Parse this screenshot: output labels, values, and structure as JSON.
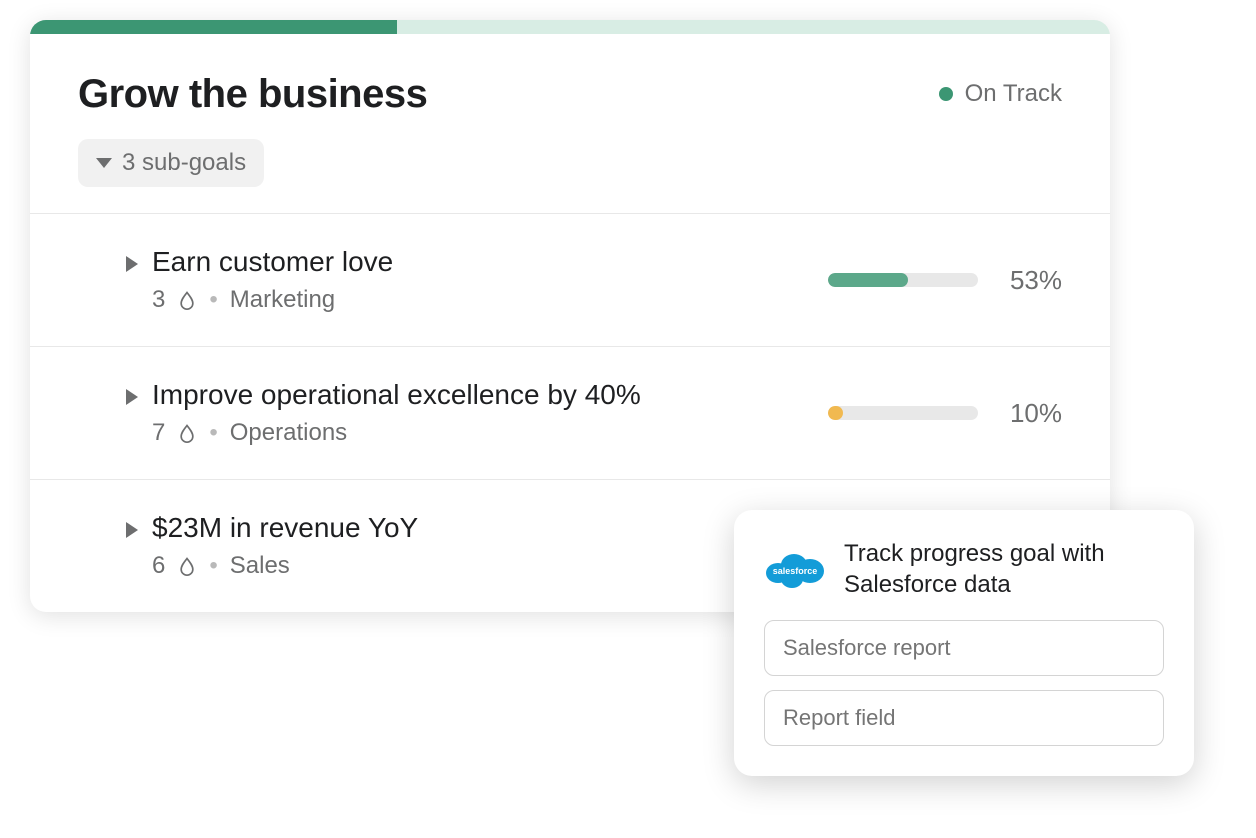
{
  "goal": {
    "title": "Grow the business",
    "status_label": "On Track",
    "status_color": "#3c9673",
    "progress_top_pct": 34,
    "subgoals_label": "3 sub-goals"
  },
  "subgoals": [
    {
      "title": "Earn customer love",
      "count": "3",
      "team": "Marketing",
      "pct_label": "53%",
      "pct": 53,
      "bar_color": "#5ca88a"
    },
    {
      "title": "Improve operational excellence by 40%",
      "count": "7",
      "team": "Operations",
      "pct_label": "10%",
      "pct": 10,
      "bar_color": "#f1b950"
    },
    {
      "title": "$23M in revenue YoY",
      "count": "6",
      "team": "Sales",
      "pct_label": "",
      "pct": 0,
      "bar_color": "#3c9673"
    }
  ],
  "popup": {
    "title": "Track progress goal with Salesforce data",
    "input1_placeholder": "Salesforce report",
    "input2_placeholder": "Report field",
    "logo_label": "salesforce"
  }
}
